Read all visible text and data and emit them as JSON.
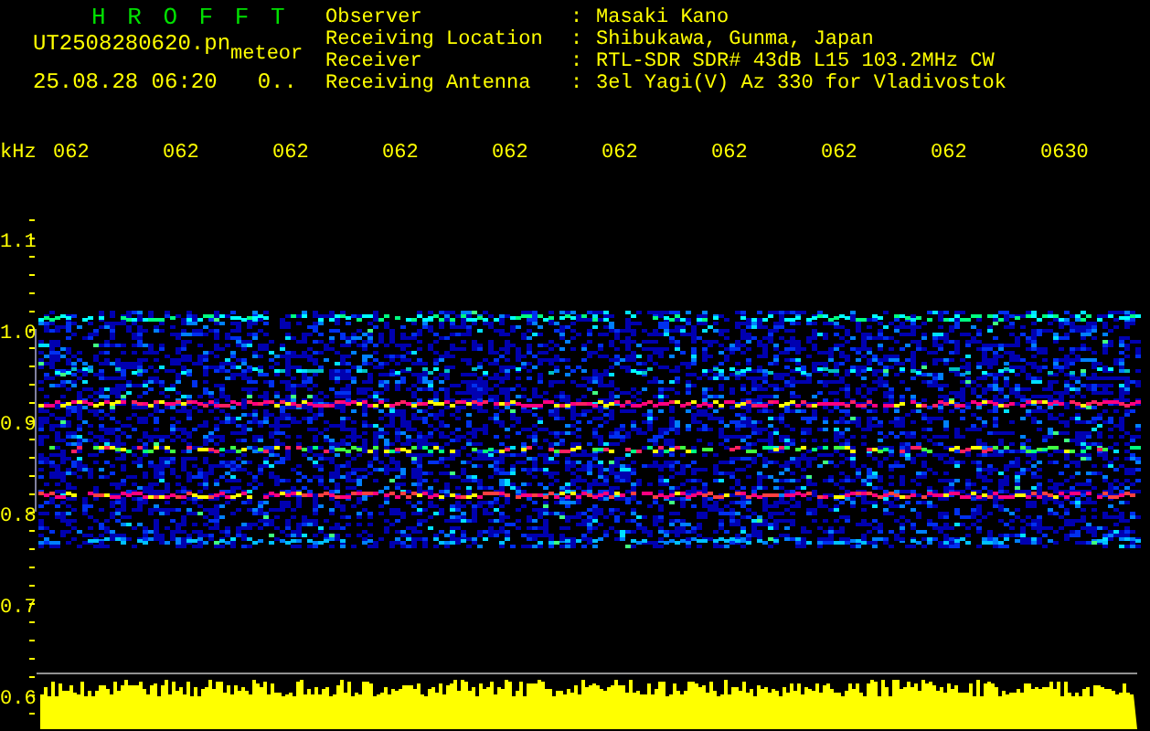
{
  "header": {
    "app_title": "H R O F F T",
    "filename": "UT2508280620.pn",
    "tag": "meteor",
    "timestamp": "25.08.28 06:20",
    "status": "0.."
  },
  "info": [
    {
      "label": "Observer",
      "separator": ":",
      "value": "Masaki Kano"
    },
    {
      "label": "Receiving Location",
      "separator": ":",
      "value": "Shibukawa, Gunma, Japan"
    },
    {
      "label": "Receiver",
      "separator": ":",
      "value": "RTL-SDR SDR# 43dB L15 103.2MHz CW"
    },
    {
      "label": "Receiving Antenna",
      "separator": ":",
      "value": "3el Yagi(V) Az 330 for Vladivostok"
    }
  ],
  "time_axis": {
    "unit": "kHz",
    "labels": [
      "062",
      "062",
      "062",
      "062",
      "062",
      "062",
      "062",
      "062",
      "062",
      "0630"
    ]
  },
  "frequency_axis": {
    "labels": [
      "1.1",
      "1.0",
      "0.9",
      "0.8",
      "0.7",
      "0.6"
    ]
  }
}
